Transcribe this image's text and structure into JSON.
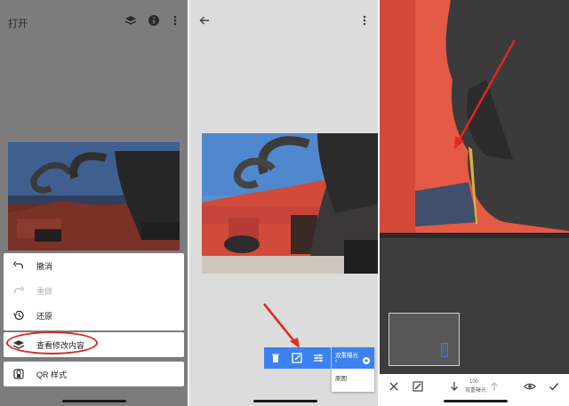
{
  "panel1": {
    "title": "打开",
    "icons": [
      "layers-stack-icon",
      "info-icon",
      "more-vert-icon"
    ],
    "menu": [
      {
        "icon": "undo-icon",
        "label": "撤消",
        "enabled": true
      },
      {
        "icon": "redo-icon",
        "label": "重做",
        "enabled": false
      },
      {
        "icon": "restore-history-icon",
        "label": "还原",
        "enabled": true
      },
      {
        "icon": "layers-icon",
        "label": "查看修改内容",
        "enabled": true,
        "highlighted": true
      },
      {
        "icon": "qr-style-icon",
        "label": "QR 样式",
        "enabled": true
      }
    ]
  },
  "panel2": {
    "toolbar_icons": [
      "delete-icon",
      "edit-brush-icon",
      "tune-sliders-icon"
    ],
    "popup": {
      "title": "双重曝光",
      "back": "‹",
      "original_label": "原图"
    }
  },
  "panel3": {
    "bottom_icons": [
      "close-icon",
      "mask-brush-icon",
      "down-arrow-icon",
      "up-arrow-icon",
      "eye-icon",
      "check-icon"
    ],
    "brush_value": "100",
    "brush_label": "双重曝光"
  },
  "colors": {
    "accent_blue": "#3b82f0",
    "highlight_red": "#d62a23",
    "wall_red": "#e0533f"
  }
}
